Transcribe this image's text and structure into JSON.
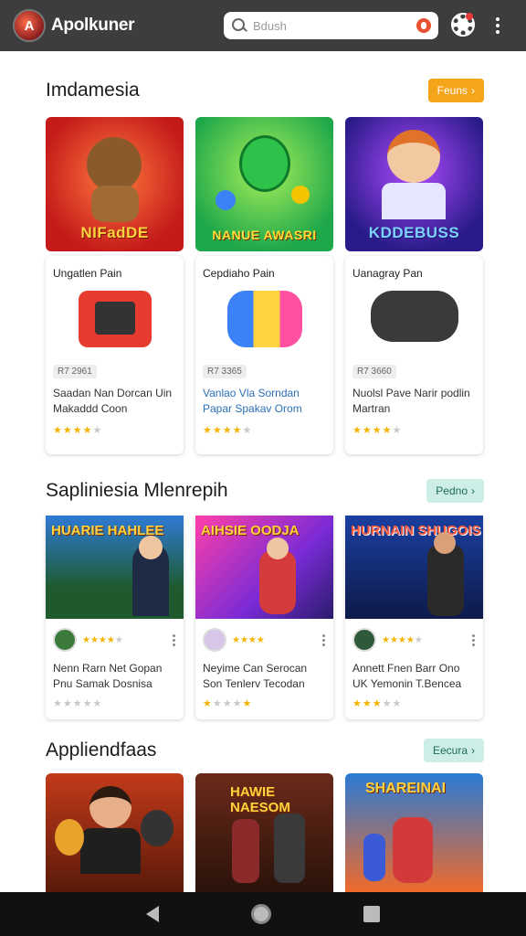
{
  "app": {
    "title": "Apolkuner",
    "logo_letter": "A"
  },
  "search": {
    "placeholder": "Bdush"
  },
  "icons": {
    "search": "search-icon",
    "mic": "mic-icon",
    "settings": "gear-icon",
    "menu": "more-vert-icon"
  },
  "colors": {
    "appbar": "#3d3d3d",
    "accent_orange": "#f6a51a",
    "accent_mint": "#cdeee6",
    "star": "#f5b301"
  },
  "section1": {
    "title": "Imdamesia",
    "button": "Feuns",
    "tiles": [
      {
        "label": "NIFadDE"
      },
      {
        "label": "NANUE AWASRI"
      },
      {
        "label": "KDDEBUSS"
      }
    ],
    "cards": [
      {
        "name": "Ungatlen Pain",
        "chip": "R7 2961",
        "desc": "Saadan Nan Dorcan Uin Makaddd Coon",
        "stars": 4
      },
      {
        "name": "Cepdiaho Pain",
        "chip": "R7 3365",
        "desc": "Vanlao Vla Sorndan Papar Spakav Orom",
        "stars": 4
      },
      {
        "name": "Uanagray Pan",
        "chip": "R7 3660",
        "desc": "Nuolsl Pave Narir podlin Martran",
        "stars": 4
      }
    ]
  },
  "section2": {
    "title": "Sapliniesia Mlenrepih",
    "button": "Pedno",
    "cards": [
      {
        "img_title": "HUARIE HAHLEE",
        "meta_stars": 4,
        "desc": "Nenn Rarn Net Gopan Pnu Samak Dosnisa",
        "stars": 0
      },
      {
        "img_title": "AIHSIE OODJA",
        "meta_stars": 4,
        "desc": "Neyime Can Serocan Son Tenlerv Tecodan",
        "stars": 1
      },
      {
        "img_title": "HURNAIN SHUGOIS",
        "meta_stars": 4,
        "desc": "Annett Fnen Barr Ono UK Yemonin T.Bencea",
        "stars": 3
      }
    ]
  },
  "section3": {
    "title": "Appliendfaas",
    "button": "Eecura",
    "tiles": [
      {
        "label": ""
      },
      {
        "label": "HAWIE NAESOM"
      },
      {
        "label": "SHAREINAI"
      }
    ]
  }
}
